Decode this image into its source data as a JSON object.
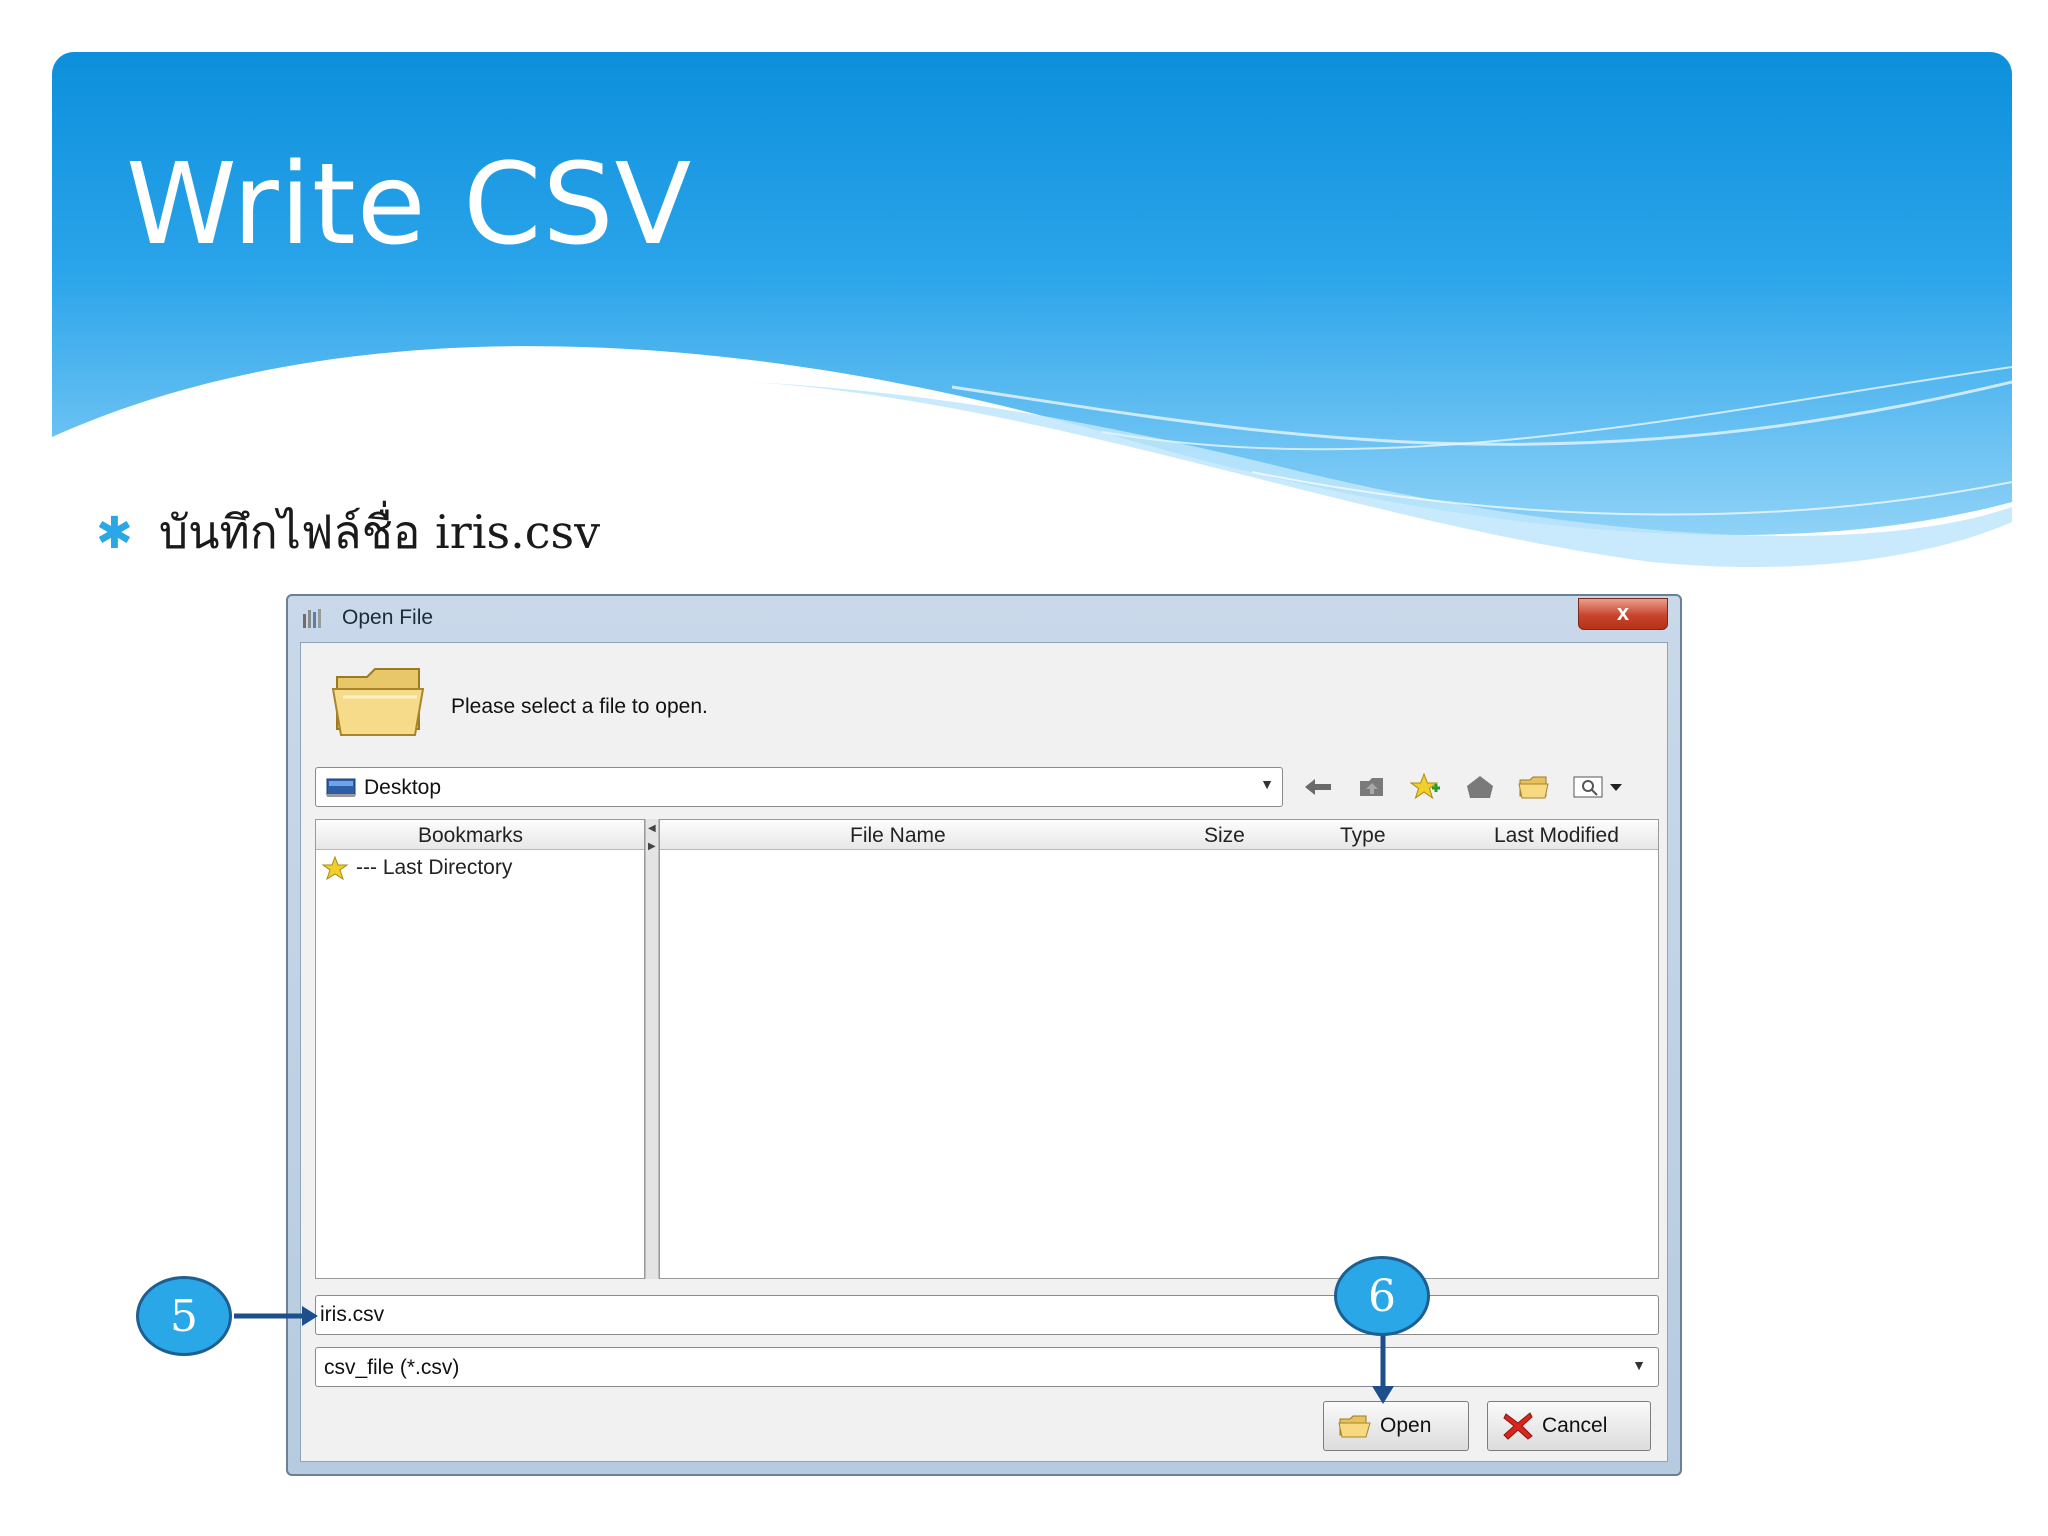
{
  "slide": {
    "title": "Write CSV",
    "bullet_text": "บันทึกไฟล์ชื่อ iris.csv"
  },
  "dialog": {
    "title": "Open File",
    "close_glyph": "x",
    "prompt": "Please select a file to open.",
    "location": "Desktop",
    "toolbar_icons": [
      "back-arrow-icon",
      "up-folder-icon",
      "add-bookmark-icon",
      "home-icon",
      "new-folder-icon",
      "view-menu-icon"
    ],
    "bookmarks": {
      "header": "Bookmarks",
      "items": [
        "--- Last Directory"
      ]
    },
    "file_table": {
      "columns": [
        "File Name",
        "Size",
        "Type",
        "Last Modified"
      ]
    },
    "filename_value": "iris.csv",
    "filetype_selected": "csv_file (*.csv)",
    "buttons": {
      "open": "Open",
      "cancel": "Cancel"
    }
  },
  "callouts": {
    "step5": "5",
    "step6": "6"
  },
  "colors": {
    "header_blue": "#1c9ee6",
    "callout_blue": "#2aa7e6",
    "arrow_navy": "#1d4f8c"
  }
}
